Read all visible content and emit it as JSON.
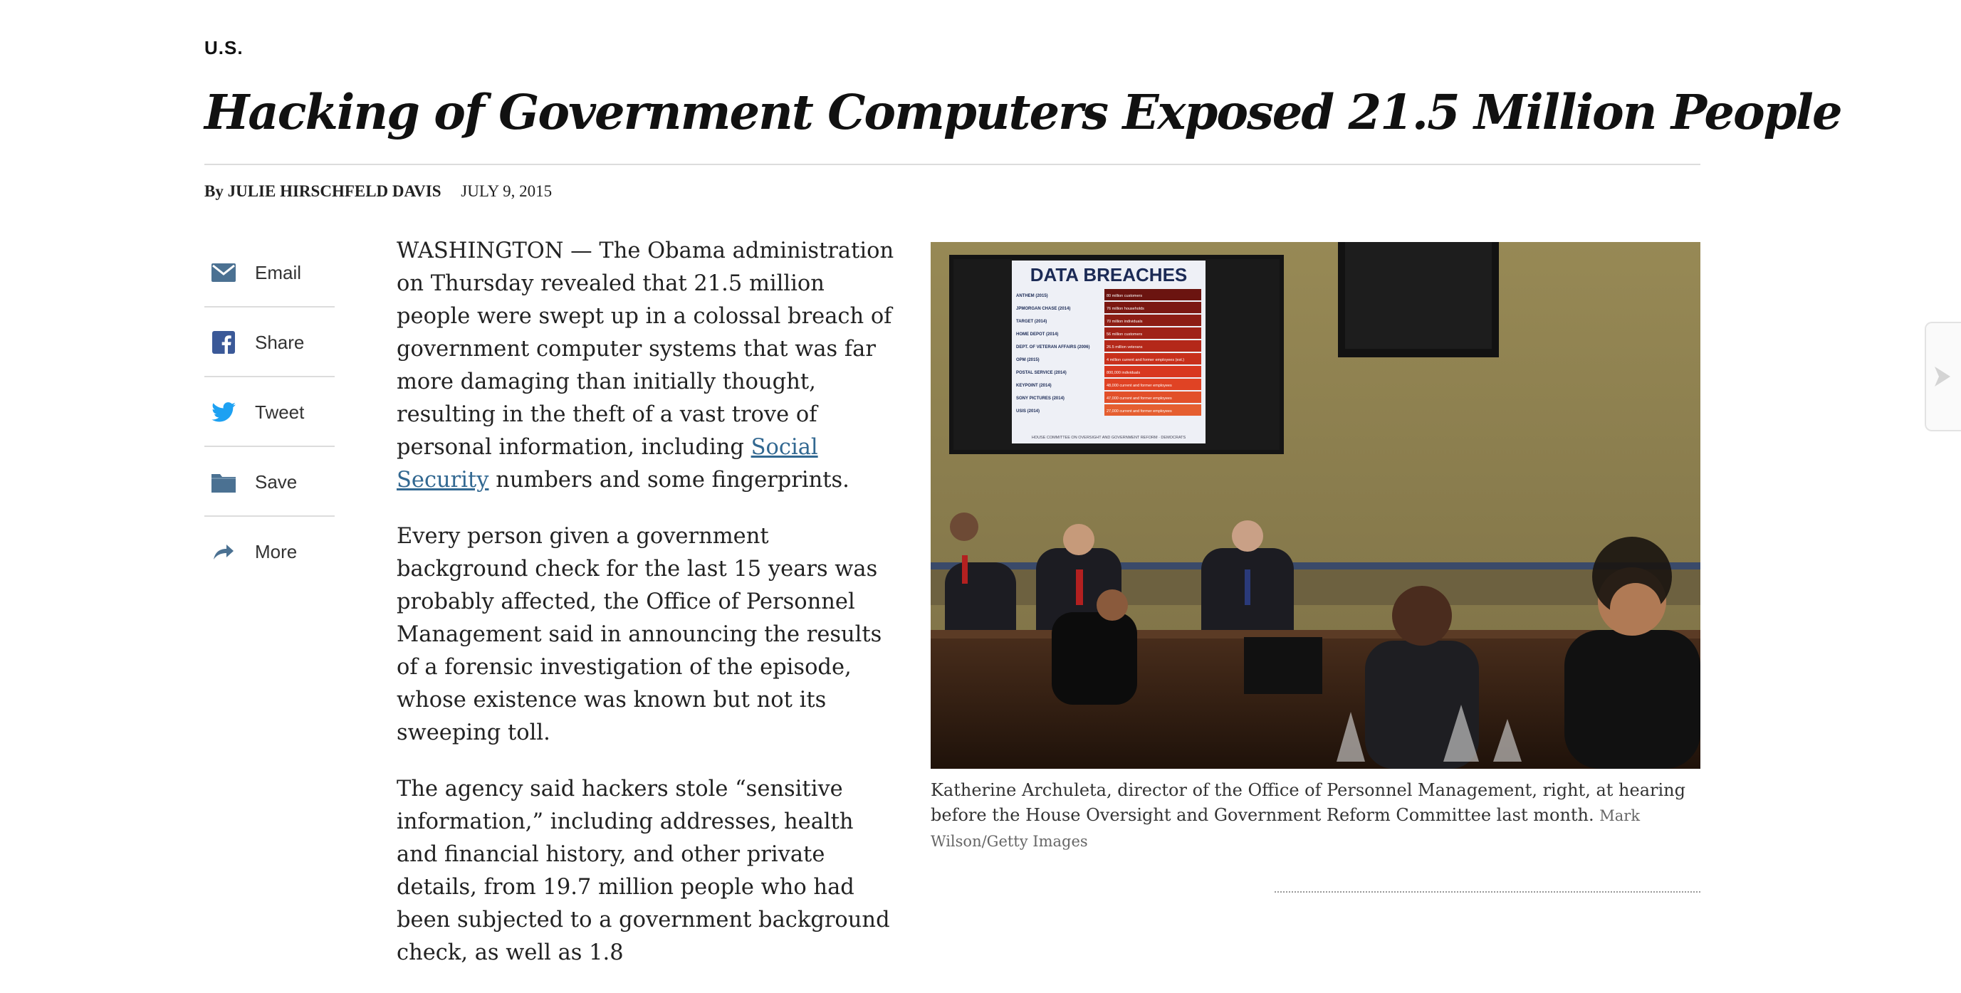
{
  "section": "U.S.",
  "headline": "Hacking of Government Computers Exposed 21.5 Million People",
  "byline": {
    "prefix": "By",
    "author": "JULIE HIRSCHFELD DAVIS",
    "date": "JULY 9, 2015"
  },
  "share": {
    "items": [
      {
        "label": "Email",
        "icon": "email-icon"
      },
      {
        "label": "Share",
        "icon": "facebook-icon"
      },
      {
        "label": "Tweet",
        "icon": "twitter-icon"
      },
      {
        "label": "Save",
        "icon": "folder-icon"
      },
      {
        "label": "More",
        "icon": "share-arrow-icon"
      }
    ]
  },
  "article": {
    "p1_before": "WASHINGTON — The Obama administration on Thursday revealed that 21.5 million people were swept up in a colossal breach of government computer systems that was far more damaging than initially thought, resulting in the theft of a vast trove of personal information, including ",
    "p1_link": "Social Security",
    "p1_after": " numbers and some fingerprints.",
    "p2": "Every person given a government background check for the last 15 years was probably affected, the Office of Personnel Management said in announcing the results of a forensic investigation of the episode, whose existence was known but not its sweeping toll.",
    "p3": "The agency said hackers stole “sensitive information,” including addresses, health and financial history, and other private details, from 19.7 million people who had been subjected to a government background check, as well as 1.8"
  },
  "photo": {
    "screen_title": "DATA BREACHES",
    "rows": [
      {
        "name": "ANTHEM (2015)",
        "value": "80 million customers"
      },
      {
        "name": "JPMORGAN CHASE (2014)",
        "value": "76 million households"
      },
      {
        "name": "TARGET (2014)",
        "value": "70 million individuals"
      },
      {
        "name": "HOME DEPOT (2014)",
        "value": "56 million customers"
      },
      {
        "name": "DEPT. OF VETERAN AFFAIRS (2006)",
        "value": "26.5 million veterans"
      },
      {
        "name": "OPM (2015)",
        "value": "4 million current and former employees (est.)"
      },
      {
        "name": "POSTAL SERVICE (2014)",
        "value": "800,000 individuals"
      },
      {
        "name": "KEYPOINT (2014)",
        "value": "48,000 current and former employees"
      },
      {
        "name": "SONY PICTURES (2014)",
        "value": "47,000 current and former employees"
      },
      {
        "name": "USIS (2014)",
        "value": "27,000 current and former employees"
      }
    ],
    "screen_footer": "HOUSE COMMITTEE ON OVERSIGHT AND GOVERNMENT REFORM · DEMOCRATS"
  },
  "caption": {
    "text": "Katherine Archuleta, director of the Office of Personnel Management, right, at hearing before the House Oversight and Government Reform Committee last month.",
    "credit": "Mark Wilson/Getty Images"
  },
  "colors": {
    "link": "#326891",
    "icon": "#4b7192",
    "facebook": "#3b5998",
    "twitter": "#1da1f2",
    "rule": "#dcdcdc"
  }
}
